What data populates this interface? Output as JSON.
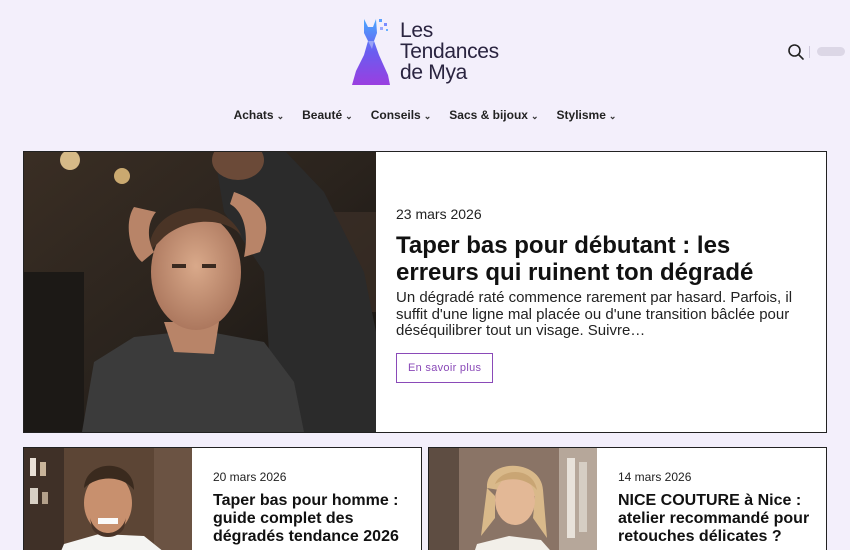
{
  "site": {
    "logo_line1": "Les",
    "logo_line2": "Tendances",
    "logo_line3": "de Mya",
    "logo_icon": "dress-icon",
    "accent_color": "#8a4ab8"
  },
  "header": {
    "search_icon": "search-icon"
  },
  "nav": {
    "items": [
      {
        "label": "Achats"
      },
      {
        "label": "Beauté"
      },
      {
        "label": "Conseils"
      },
      {
        "label": "Sacs & bijoux"
      },
      {
        "label": "Stylisme"
      }
    ]
  },
  "featured": {
    "date": "23 mars 2026",
    "title": "Taper bas pour débutant : les erreurs qui ruinent ton dégradé",
    "excerpt": "Un dégradé raté commence rarement par hasard. Parfois, il suffit d'une ligne mal placée ou d'une transition bâclée pour déséquilibrer tout un visage. Suivre…",
    "button_label": "En savoir plus"
  },
  "cards": [
    {
      "date": "20 mars 2026",
      "title": "Taper bas pour homme : guide complet des dégradés tendance 2026"
    },
    {
      "date": "14 mars 2026",
      "title": "NICE COUTURE à Nice : atelier recommandé pour retouches délicates ?"
    }
  ]
}
